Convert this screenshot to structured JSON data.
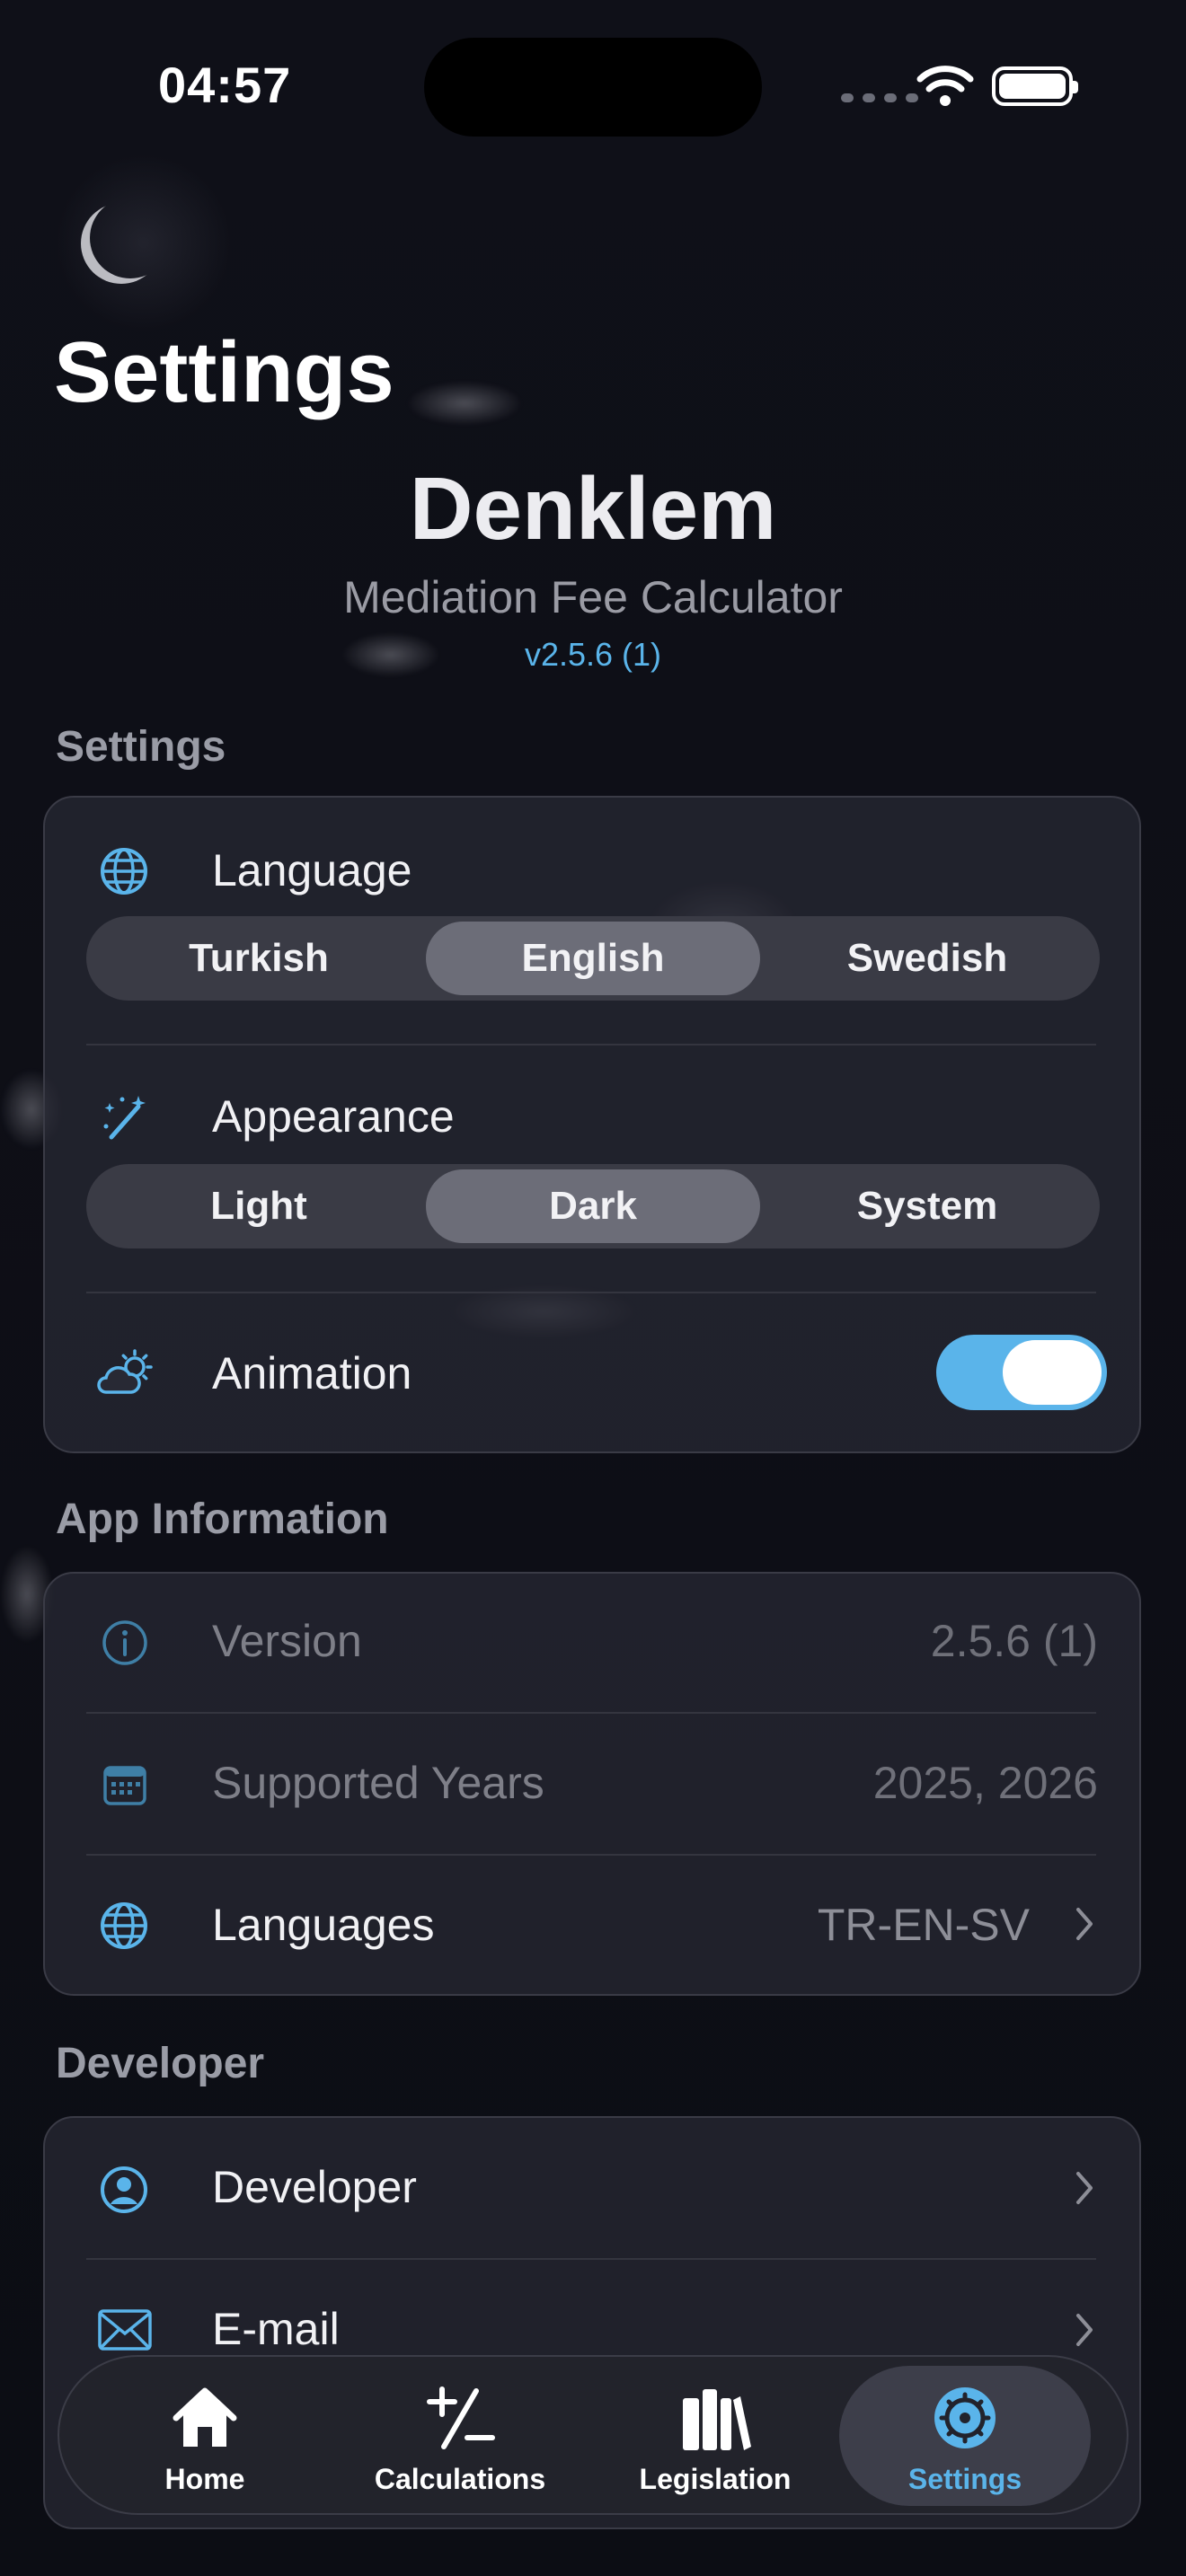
{
  "status_bar": {
    "time": "04:57"
  },
  "header": {
    "page_title": "Settings",
    "app_name": "Denklem",
    "app_subtitle": "Mediation Fee Calculator",
    "app_version": "v2.5.6 (1)"
  },
  "settings_section": {
    "title": "Settings",
    "language": {
      "label": "Language",
      "icon": "globe-icon",
      "options": [
        "Turkish",
        "English",
        "Swedish"
      ],
      "selected": "English"
    },
    "appearance": {
      "label": "Appearance",
      "icon": "magic-wand-icon",
      "options": [
        "Light",
        "Dark",
        "System"
      ],
      "selected": "Dark"
    },
    "animation": {
      "label": "Animation",
      "icon": "cloud-sun-icon",
      "enabled": true
    }
  },
  "app_info_section": {
    "title": "App Information",
    "rows": [
      {
        "label": "Version",
        "value": "2.5.6 (1)",
        "icon": "info-icon"
      },
      {
        "label": "Supported Years",
        "value": "2025, 2026",
        "icon": "calendar-icon"
      },
      {
        "label": "Languages",
        "value": "TR-EN-SV",
        "icon": "globe-icon"
      }
    ]
  },
  "developer_section": {
    "title": "Developer",
    "rows": [
      {
        "label": "Developer",
        "icon": "person-circle-icon"
      },
      {
        "label": "E-mail",
        "icon": "envelope-icon"
      }
    ]
  },
  "tab_bar": {
    "tabs": [
      {
        "label": "Home",
        "icon": "house-icon"
      },
      {
        "label": "Calculations",
        "icon": "plus-minus-icon"
      },
      {
        "label": "Legislation",
        "icon": "books-icon"
      },
      {
        "label": "Settings",
        "icon": "gear-icon"
      }
    ],
    "active": "Settings"
  },
  "colors": {
    "accent": "#5ab4ea",
    "background": "#0f1018",
    "card": "#282934"
  }
}
